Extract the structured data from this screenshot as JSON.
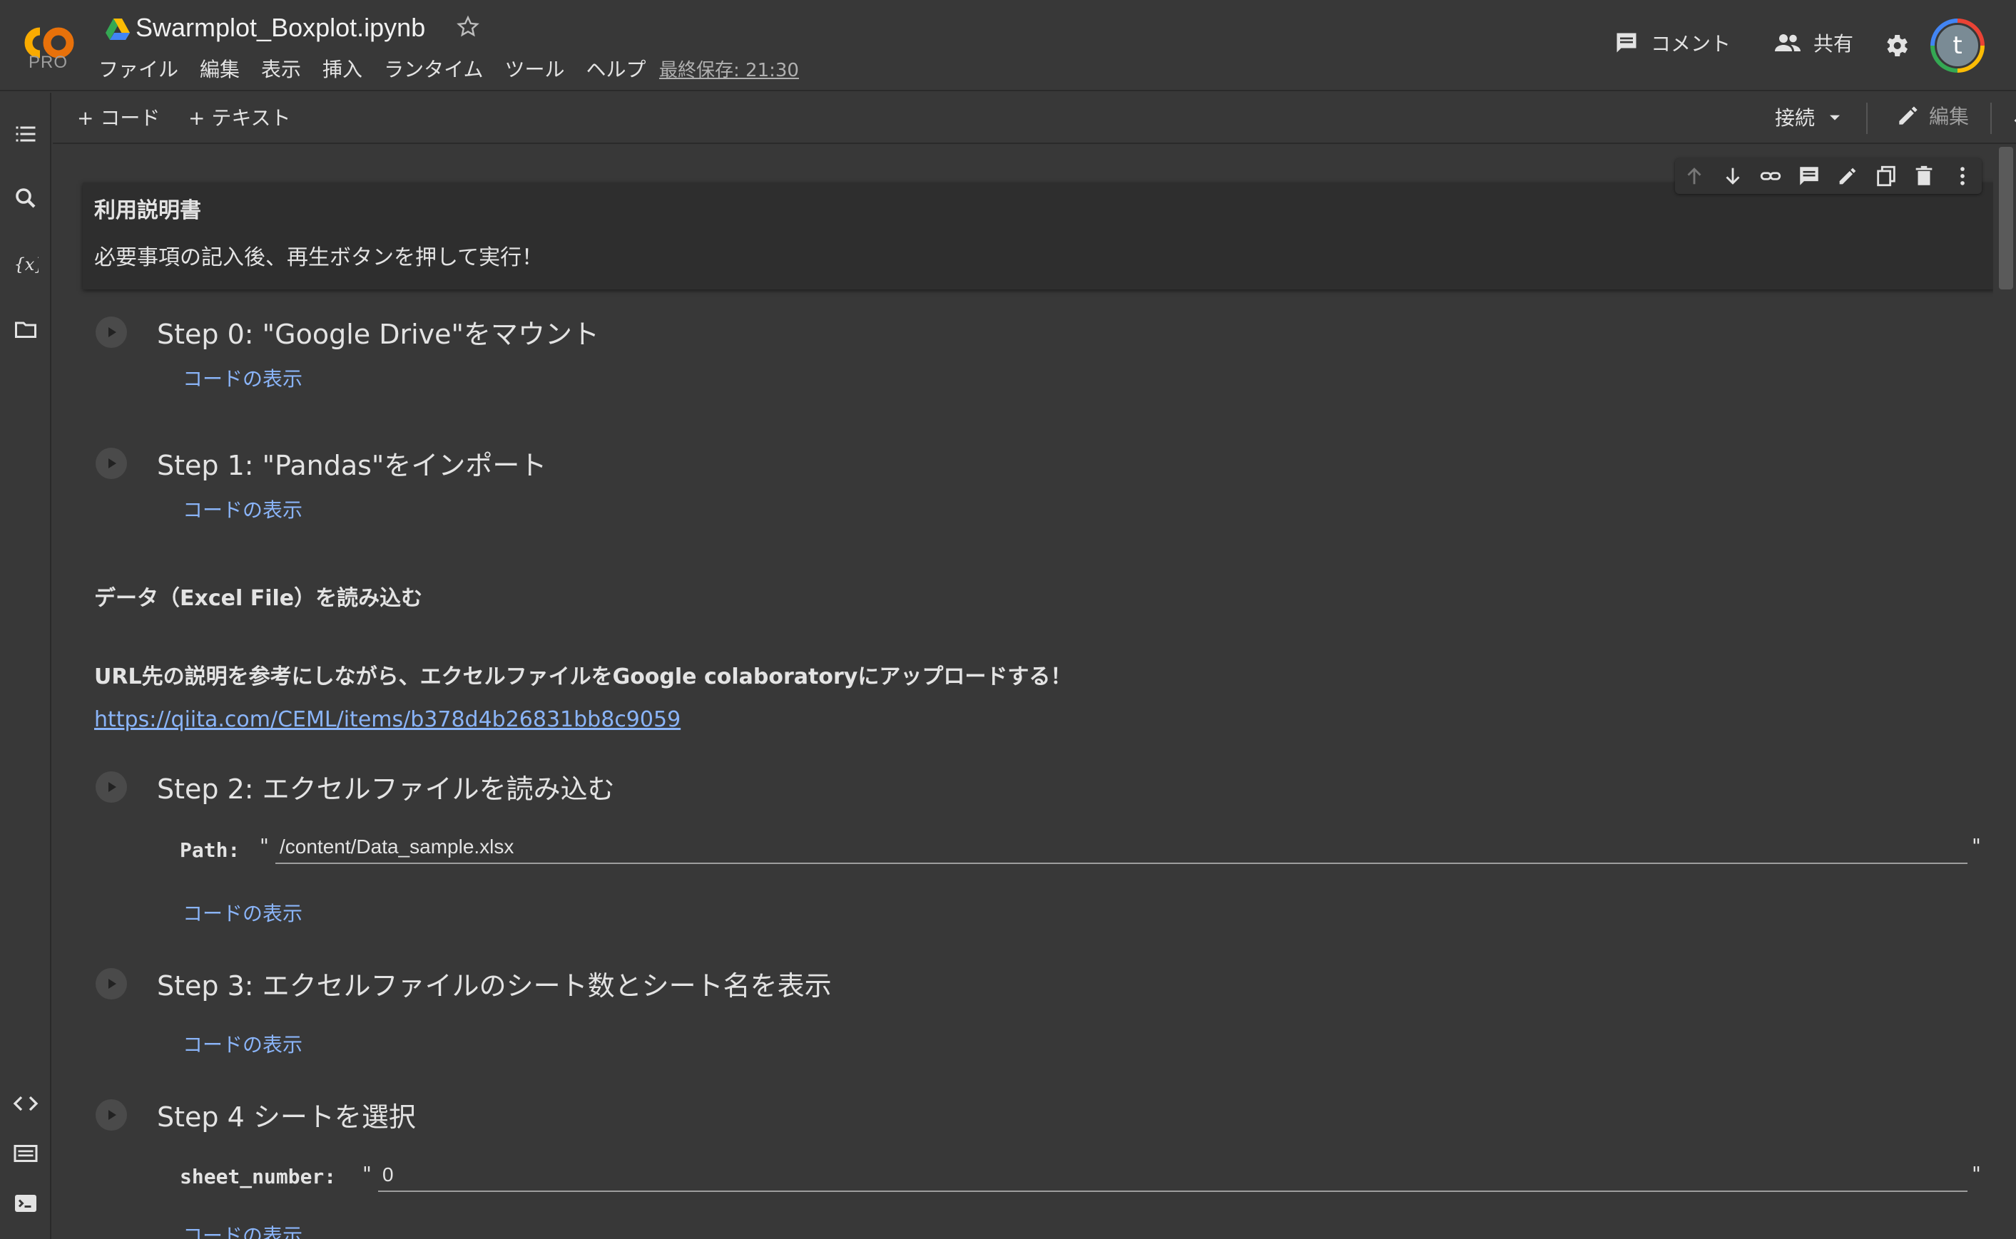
{
  "header": {
    "logo_text": "PRO",
    "notebook_title": "Swarmplot_Boxplot.ipynb",
    "menu": [
      "ファイル",
      "編集",
      "表示",
      "挿入",
      "ランタイム",
      "ツール",
      "ヘルプ"
    ],
    "last_saved": "最終保存: 21:30",
    "comment_label": "コメント",
    "share_label": "共有",
    "avatar_initial": "t",
    "colors": {
      "logo_orange": "#f9ab00",
      "logo_yellow": "#e8710a"
    }
  },
  "toolbar": {
    "add_code": "+ コード",
    "add_text": "+ テキスト",
    "connect": "接続",
    "edit": "編集"
  },
  "cells": {
    "intro_heading": "利用説明書",
    "intro_body": "必要事項の記入後、再生ボタンを押して実行！",
    "step0_title": "Step 0: \"Google Drive\"をマウント",
    "step1_title": "Step 1: \"Pandas\"をインポート",
    "data_heading": "データ（Excel File）を読み込む",
    "upload_instruction": "URL先の説明を参考にしながら、エクセルファイルをGoogle colaboratoryにアップロードする！",
    "link_url": "https://qiita.com/CEML/items/b378d4b26831bb8c9059",
    "step2_title": "Step 2: エクセルファイルを読み込む",
    "path_label": "Path:",
    "path_value": "/content/Data_sample.xlsx",
    "step3_title": "Step 3: エクセルファイルのシート数とシート名を表示",
    "step4_title": "Step 4 シートを選択",
    "sheet_label": "sheet_number:",
    "sheet_value": "0",
    "show_code": "コードの表示",
    "quote": "\""
  }
}
